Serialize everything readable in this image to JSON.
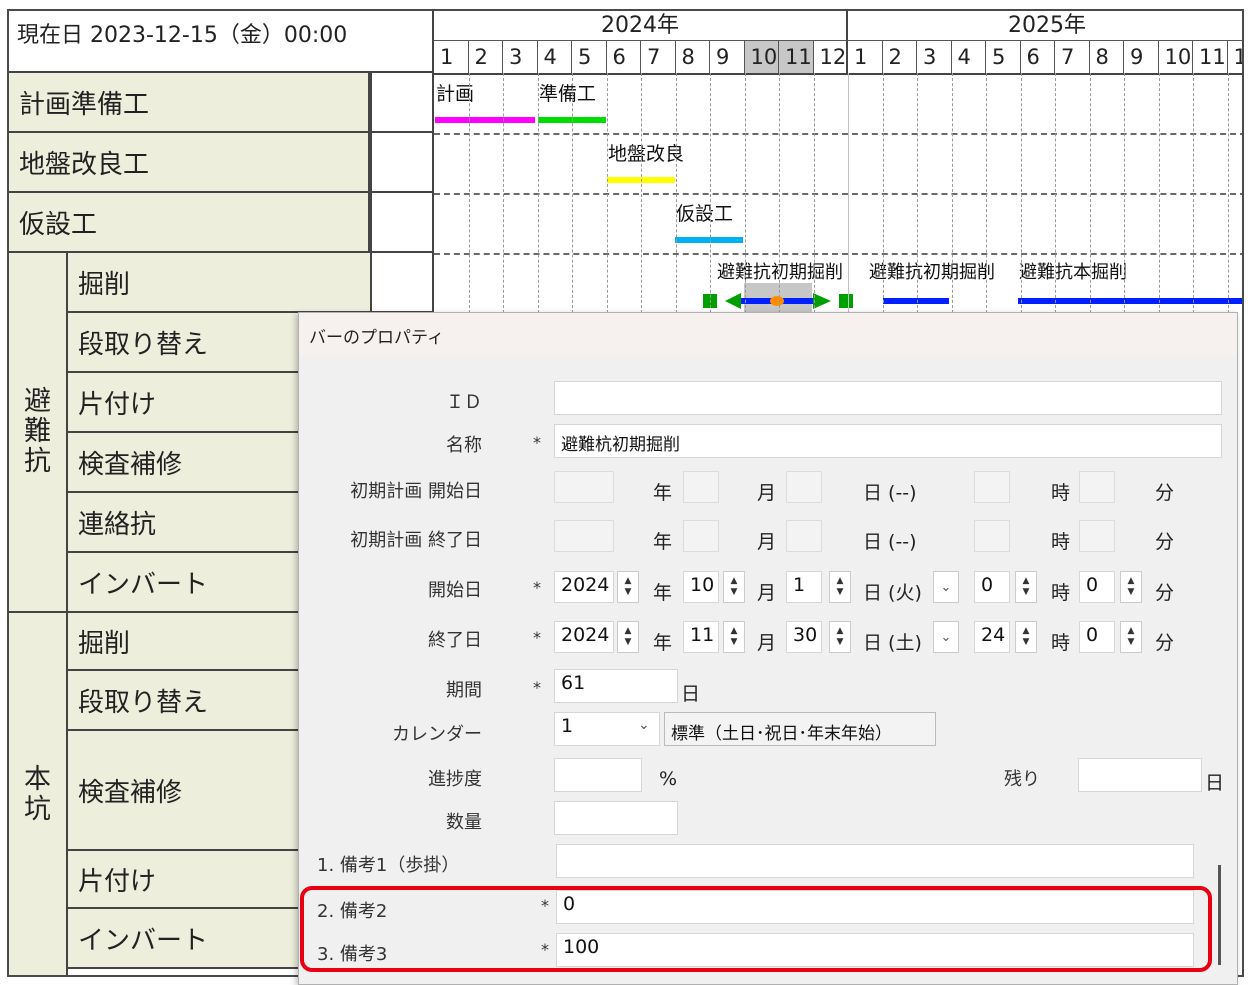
{
  "gantt": {
    "current_date": "現在日 2023-12-15（金）00:00",
    "years": [
      "2024年",
      "2025年"
    ],
    "months_2024": [
      "1",
      "2",
      "3",
      "4",
      "5",
      "6",
      "7",
      "8",
      "9",
      "10",
      "11",
      "12"
    ],
    "months_2025": [
      "1",
      "2",
      "3",
      "4",
      "5",
      "6",
      "7",
      "8",
      "9",
      "10",
      "11",
      "1"
    ],
    "rows": {
      "keikaku": "計画準備工",
      "jiban": "地盤改良工",
      "kasetsu": "仮設工",
      "hinan_group": "避難抗",
      "honko_group": "本坑",
      "hinan_items": [
        "掘削",
        "段取り替え",
        "片付け",
        "検査補修",
        "連絡抗",
        "インバート"
      ],
      "honko_items": [
        "掘削",
        "段取り替え",
        "検査補修",
        "片付け",
        "インバート"
      ]
    },
    "bars": {
      "keikaku": "計画",
      "junbi": "準備工",
      "jiban": "地盤改良",
      "kasetsu": "仮設工",
      "hinan1": "避難抗初期掘削",
      "hinan2": "避難抗初期掘削",
      "hinan3": "避難抗本掘削"
    },
    "colors": {
      "keikaku": "#ff00ff",
      "junbi": "#00dd00",
      "jiban": "#ffff00",
      "kasetsu": "#00b0f0",
      "hinan": "#0020ff",
      "handle": "#00a000",
      "marker": "#ff8c00"
    }
  },
  "dialog": {
    "title": "バーのプロパティ",
    "labels": {
      "id": "ＩＤ",
      "name": "名称",
      "init_start": "初期計画 開始日",
      "init_end": "初期計画 終了日",
      "start": "開始日",
      "end": "終了日",
      "period": "期間",
      "calendar": "カレンダー",
      "progress": "進捗度",
      "remaining": "残り",
      "quantity": "数量",
      "note1": "1. 備考1（歩掛）",
      "note2": "2. 備考2",
      "note3": "3. 備考3"
    },
    "units": {
      "year": "年",
      "month": "月",
      "day_blank": "日 (--)",
      "hour": "時",
      "minute": "分",
      "day": "日",
      "percent": "%"
    },
    "required_mark": "*",
    "values": {
      "id": "",
      "name": "避難杭初期掘削",
      "start_year": "2024",
      "start_month": "10",
      "start_day": "1",
      "start_weekday": "日 (火)",
      "start_hour": "0",
      "start_minute": "0",
      "end_year": "2024",
      "end_month": "11",
      "end_day": "30",
      "end_weekday": "日 (土)",
      "end_hour": "24",
      "end_minute": "0",
      "period": "61",
      "calendar_id": "1",
      "calendar_name": "標準（土日･祝日･年末年始）",
      "progress": "",
      "remaining": "",
      "quantity": "",
      "note1": "",
      "note2": "0",
      "note3": "100"
    },
    "highlight_color": "#e60012"
  }
}
